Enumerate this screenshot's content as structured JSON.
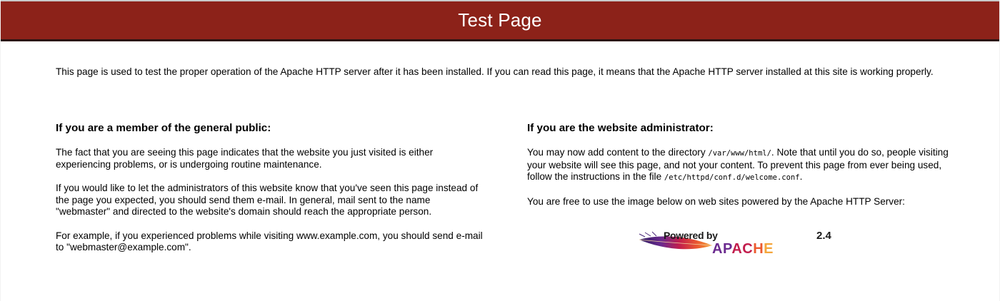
{
  "header": {
    "title": "Test Page"
  },
  "intro": {
    "text": "This page is used to test the proper operation of the Apache HTTP server after it has been installed. If you can read this page, it means that the Apache HTTP server installed at this site is working properly."
  },
  "public_section": {
    "heading": "If you are a member of the general public:",
    "paragraphs": [
      "The fact that you are seeing this page indicates that the website you just visited is either experiencing problems, or is undergoing routine maintenance.",
      "If you would like to let the administrators of this website know that you've seen this page instead of the page you expected, you should send them e-mail. In general, mail sent to the name \"webmaster\" and directed to the website's domain should reach the appropriate person.",
      "For example, if you experienced problems while visiting www.example.com, you should send e-mail to \"webmaster@example.com\"."
    ]
  },
  "admin_section": {
    "heading": "If you are the website administrator:",
    "p1_before": "You may now add content to the directory ",
    "p1_path": "/var/www/html/",
    "p1_after": ". Note that until you do so, people visiting your website will see this page, and not your content. To prevent this page from ever being used, follow the instructions in the file ",
    "p1_file": "/etc/httpd/conf.d/welcome.conf",
    "p1_end": ".",
    "p2": "You are free to use the image below on web sites powered by the Apache HTTP Server:"
  },
  "badge": {
    "powered_by": "Powered by",
    "version": "2.4",
    "wordmark": "APACHE",
    "icon": "apache-feather-icon"
  },
  "colors": {
    "banner": "#8c2219",
    "banner_text": "#ffffff",
    "background": "#ffffff"
  }
}
